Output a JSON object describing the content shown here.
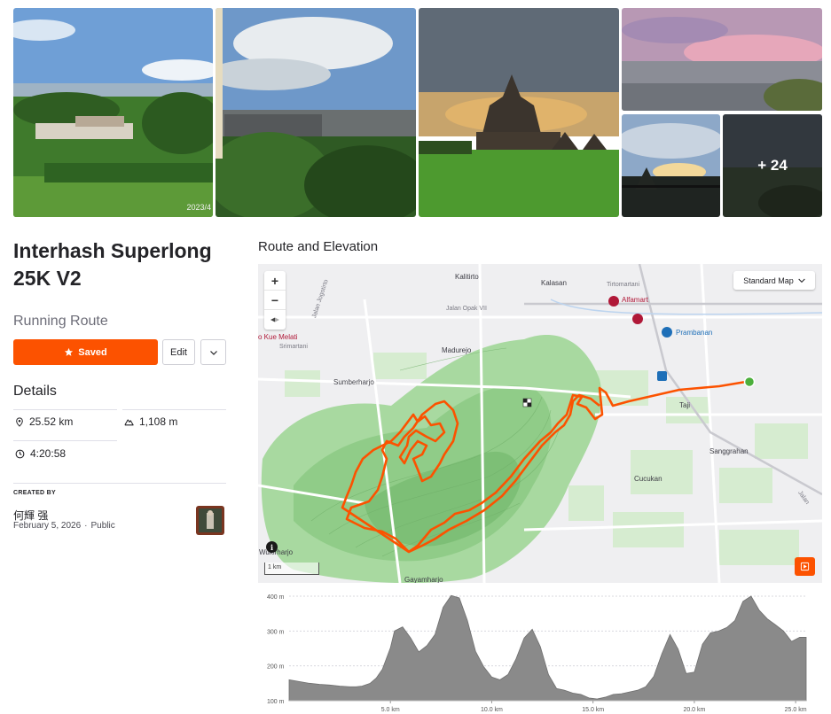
{
  "gallery": {
    "photo1_stamp": "2023/4",
    "more_photos": "+ 24"
  },
  "route": {
    "title": "Interhash Superlong 25K V2",
    "type": "Running Route"
  },
  "actions": {
    "saved_label": "Saved",
    "edit_label": "Edit"
  },
  "details": {
    "heading": "Details",
    "distance": "25.52 km",
    "elevation_gain": "1,108 m",
    "time": "4:20:58"
  },
  "creator": {
    "label": "CREATED BY",
    "name": "何輝 强",
    "date": "February 5, 2026",
    "separator": "·",
    "visibility": "Public"
  },
  "map": {
    "heading": "Route and Elevation",
    "style_select": "Standard Map",
    "zoom_in": "+",
    "zoom_out": "−",
    "scale_label": "1 km",
    "info": "i",
    "places": {
      "kalitirto": "Kalitirto",
      "kalasan": "Kalasan",
      "tirtomartani": "Tirtomartani",
      "jalan_opak": "Jalan Opak VII",
      "jalan_jogotirto": "Jalan Jogotirto",
      "alfamart": "Alfamart",
      "kue_melati": "o Kue Melati",
      "srimartani": "Srimartani",
      "madurejo": "Madurejo",
      "prambanan": "Prambanan",
      "sumberharjo": "Sumberharjo",
      "taji": "Taji",
      "sanggrahan": "Sanggrahan",
      "cucukan": "Cucukan",
      "jalan": "Jalan",
      "wukirharjo": "Wukirharjo",
      "gayamharjo": "Gayamharjo"
    }
  },
  "chart_data": {
    "type": "area",
    "title": "",
    "xlabel": "",
    "ylabel": "",
    "y_ticks": [
      "100 m",
      "200 m",
      "300 m",
      "400 m"
    ],
    "x_ticks": [
      "5.0 km",
      "10.0 km",
      "15.0 km",
      "20.0 km",
      "25.0 km"
    ],
    "xlim": [
      0,
      25.52
    ],
    "ylim": [
      100,
      400
    ],
    "x": [
      0,
      0.5,
      1,
      1.5,
      2,
      2.5,
      3,
      3.3,
      3.6,
      4,
      4.3,
      4.6,
      5.0,
      5.2,
      5.6,
      6.0,
      6.4,
      6.8,
      7.2,
      7.6,
      8.0,
      8.4,
      8.8,
      9.2,
      9.6,
      10.0,
      10.4,
      10.8,
      11.2,
      11.6,
      12.0,
      12.4,
      12.8,
      13.2,
      13.6,
      14.0,
      14.4,
      14.8,
      15.2,
      15.6,
      16.0,
      16.4,
      16.8,
      17.2,
      17.6,
      18.0,
      18.4,
      18.8,
      19.2,
      19.6,
      20.0,
      20.4,
      20.8,
      21.2,
      21.6,
      22.0,
      22.4,
      22.8,
      23.2,
      23.6,
      24.0,
      24.4,
      24.8,
      25.2,
      25.52
    ],
    "series": [
      {
        "values": [
          160,
          155,
          150,
          147,
          145,
          142,
          140,
          140,
          142,
          150,
          165,
          190,
          252,
          300,
          312,
          280,
          240,
          258,
          290,
          368,
          402,
          395,
          330,
          242,
          198,
          168,
          160,
          175,
          220,
          280,
          305,
          255,
          175,
          135,
          130,
          122,
          118,
          108,
          105,
          110,
          118,
          120,
          125,
          130,
          140,
          170,
          235,
          290,
          248,
          178,
          182,
          262,
          295,
          300,
          310,
          330,
          385,
          400,
          360,
          335,
          318,
          300,
          270,
          282,
          282
        ]
      }
    ],
    "grid": true,
    "fill_color": "#8a8a8a"
  },
  "colors": {
    "accent": "#fc5200",
    "route_line": "#fc5200",
    "start_marker": "#4caf3c",
    "poi": "#b01838",
    "link_blue": "#1e6fb8"
  }
}
